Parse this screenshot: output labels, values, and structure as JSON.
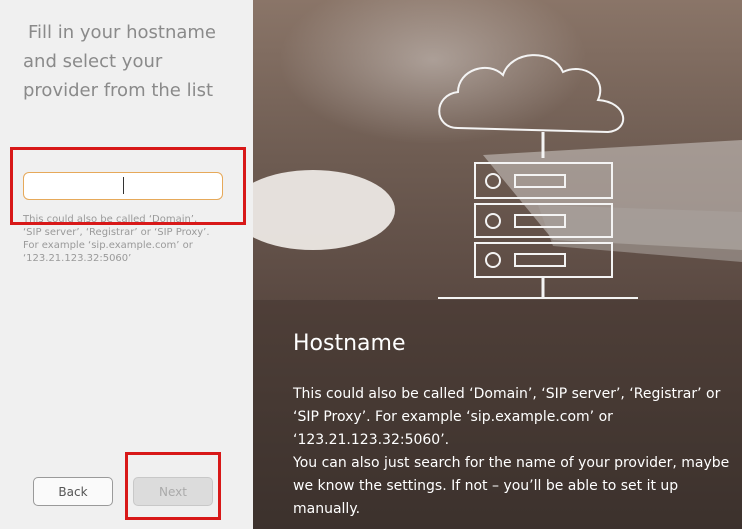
{
  "left_panel": {
    "heading_lines": [
      "Fill in your hostname",
      "and select your",
      "provider from the list"
    ],
    "hostname_input": {
      "value": "",
      "placeholder": ""
    },
    "hint_lines": [
      "This could also be called ‘Domain’,",
      "‘SIP server’, ‘Registrar’ or ‘SIP Proxy’.",
      "For example ‘sip.example.com’ or",
      "‘123.21.123.32:5060’"
    ],
    "back_label": "Back",
    "next_label": "Next"
  },
  "info_panel": {
    "title": "Hostname",
    "body_lines": [
      " This could also be called ‘Domain’, ‘SIP server’, ‘Registrar’ or",
      "‘SIP Proxy’. For example ‘sip.example.com’ or",
      "‘123.21.123.32:5060’.",
      "You can also just search for the name of your provider, maybe",
      "we know the settings. If not – you’ll be able to set it up",
      "manually."
    ]
  },
  "colors": {
    "highlight": "#d81818",
    "input_focus_border": "#e6a95a",
    "panel_background": "#f0f0f0"
  }
}
